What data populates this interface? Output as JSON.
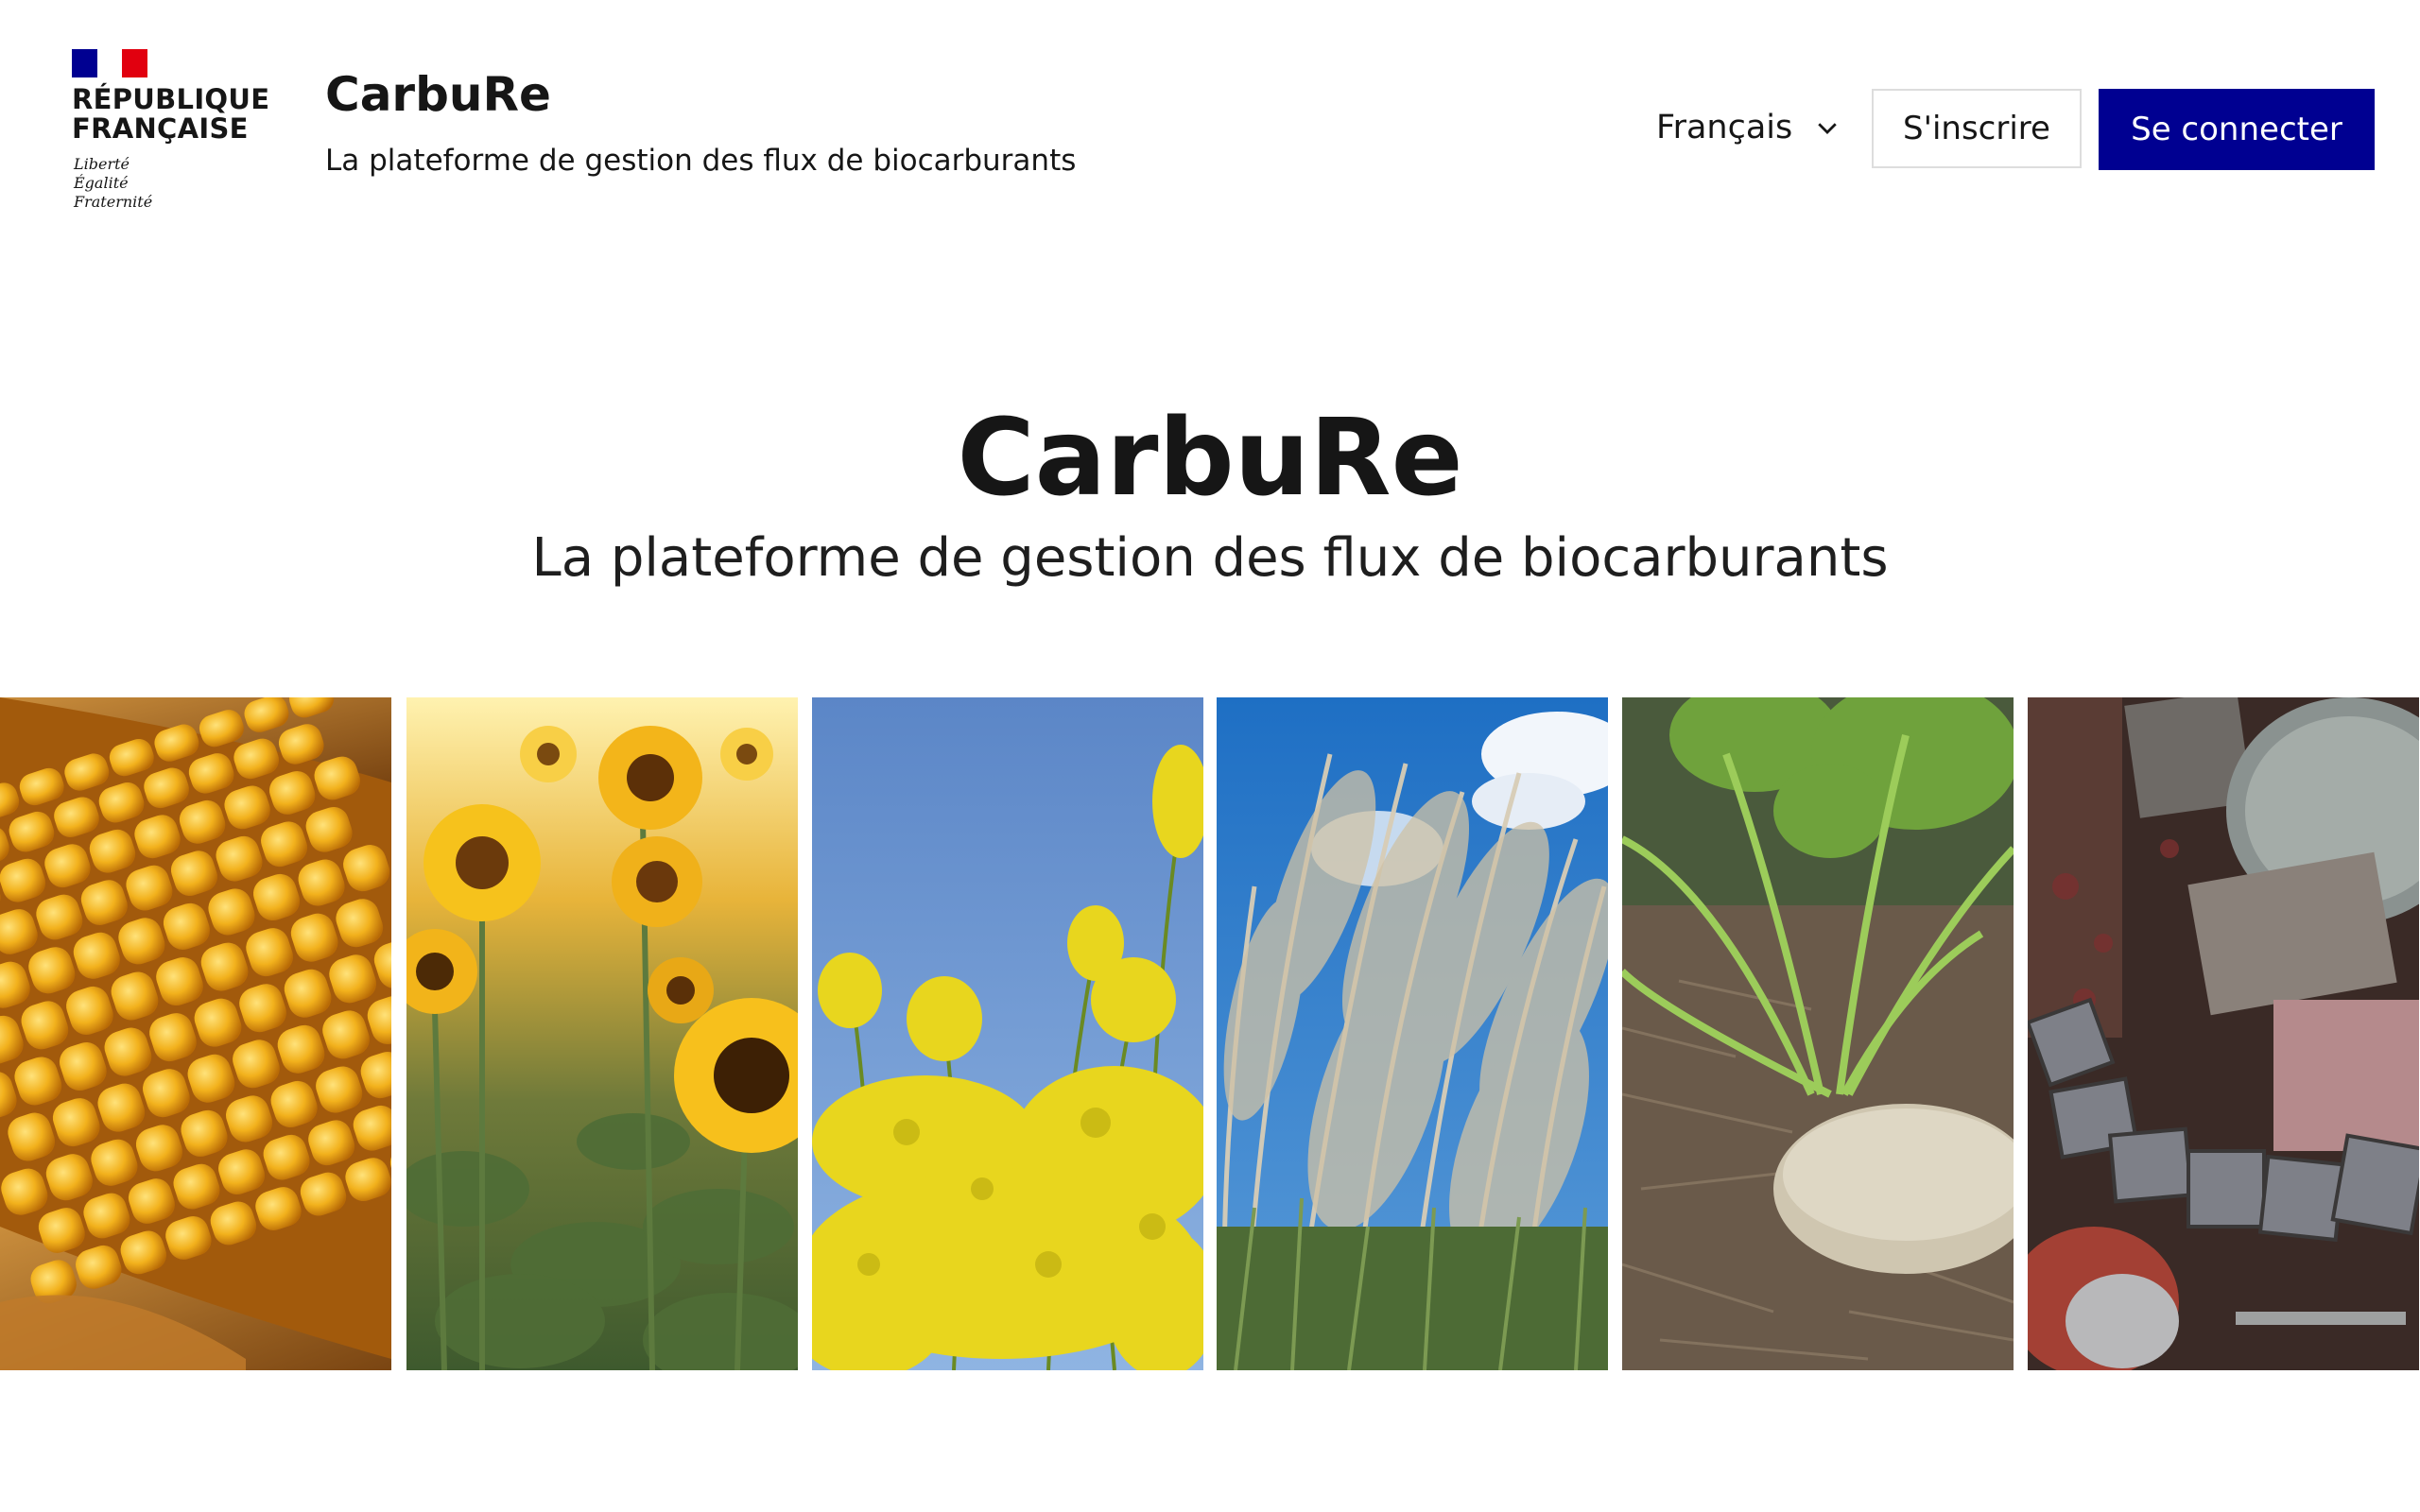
{
  "logo": {
    "name_line1": "RÉPUBLIQUE",
    "name_line2": "FRANÇAISE",
    "motto": [
      "Liberté",
      "Égalité",
      "Fraternité"
    ],
    "flag_colors": [
      "#000091",
      "#ffffff",
      "#e1000f"
    ]
  },
  "header": {
    "service_name": "CarbuRe",
    "tagline": "La plateforme de gestion des flux de biocarburants",
    "language": "Français",
    "register_label": "S'inscrire",
    "login_label": "Se connecter"
  },
  "hero": {
    "title": "CarbuRe",
    "subtitle": "La plateforme de gestion des flux de biocarburants"
  },
  "gallery": {
    "images": [
      "corn",
      "sunflowers",
      "rapeseed",
      "miscanthus-grass",
      "sugar-beet",
      "used-cooking-oil-residues"
    ]
  },
  "colors": {
    "primary": "#000091",
    "text": "#161616",
    "border": "#dddddd"
  }
}
